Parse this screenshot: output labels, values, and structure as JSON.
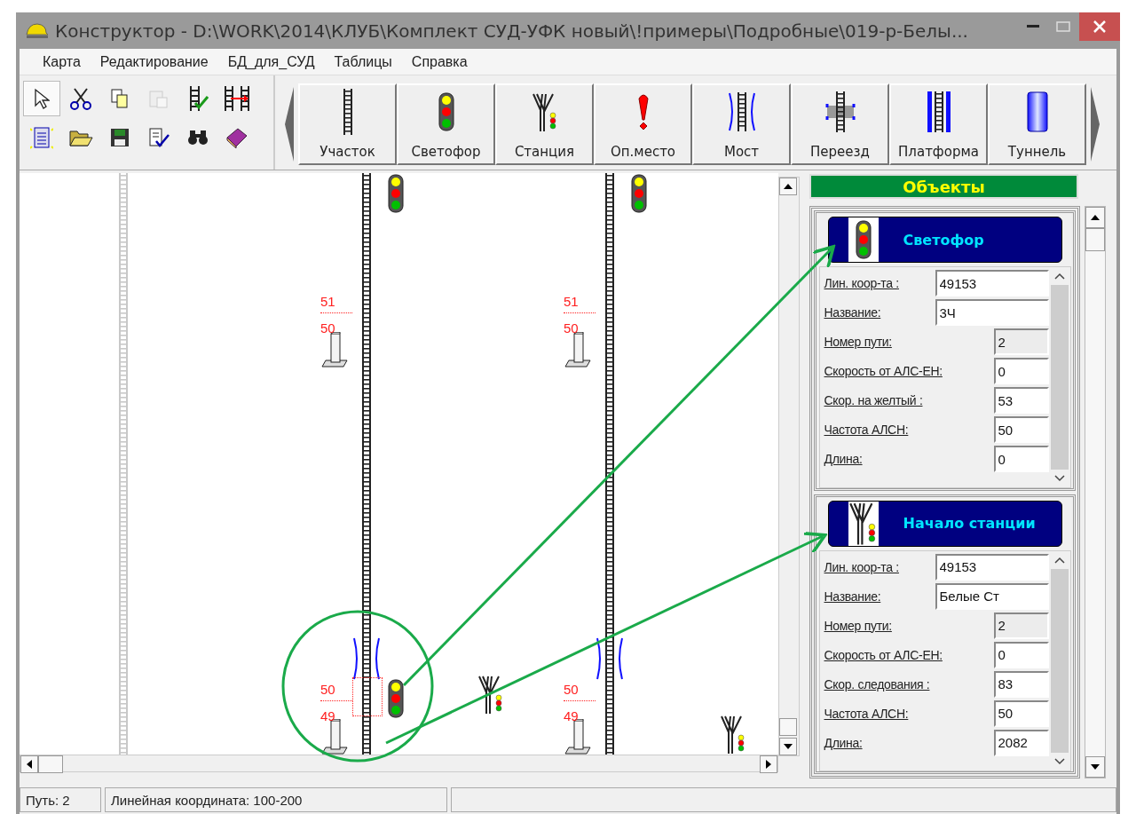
{
  "window": {
    "title": "Конструктор - D:\\WORK\\2014\\КЛУБ\\Комплект СУД-УФК новый\\!примеры\\Подробные\\019-р-Белы..."
  },
  "menu": [
    "Карта",
    "Редактирование",
    "БД_для_СУД",
    "Таблицы",
    "Справка"
  ],
  "tools": [
    [
      {
        "kind": "pointer",
        "selected": true,
        "disabled": false
      },
      {
        "kind": "cut",
        "selected": false,
        "disabled": false
      },
      {
        "kind": "copy",
        "selected": false,
        "disabled": false
      },
      {
        "kind": "paste",
        "selected": false,
        "disabled": true
      },
      {
        "kind": "check-track",
        "selected": false,
        "disabled": false
      },
      {
        "kind": "move-track",
        "selected": false,
        "disabled": false
      }
    ],
    [
      {
        "kind": "new",
        "selected": false,
        "disabled": false
      },
      {
        "kind": "open",
        "selected": false,
        "disabled": false
      },
      {
        "kind": "save",
        "selected": false,
        "disabled": false
      },
      {
        "kind": "verify",
        "selected": false,
        "disabled": false
      },
      {
        "kind": "find",
        "selected": false,
        "disabled": false
      },
      {
        "kind": "help",
        "selected": false,
        "disabled": false
      }
    ]
  ],
  "palette": [
    {
      "kind": "track",
      "label": "Участок"
    },
    {
      "kind": "signal",
      "label": "Светофор"
    },
    {
      "kind": "station",
      "label": "Станция"
    },
    {
      "kind": "danger",
      "label": "Оп.место"
    },
    {
      "kind": "bridge",
      "label": "Мост"
    },
    {
      "kind": "crossing",
      "label": "Переезд"
    },
    {
      "kind": "platform",
      "label": "Платформа"
    },
    {
      "kind": "tunnel",
      "label": "Туннель"
    }
  ],
  "canvas": {
    "marks": [
      {
        "upper": "51",
        "lower": "50",
        "selected": false
      },
      {
        "upper": "51",
        "lower": "50",
        "selected": false
      },
      {
        "upper": "50",
        "lower": "49",
        "selected": true
      },
      {
        "upper": "50",
        "lower": "49",
        "selected": false
      }
    ]
  },
  "panel": {
    "title": "Объекты",
    "cards": [
      {
        "kind": "signal",
        "title": "Светофор",
        "fields": [
          {
            "kind": "text",
            "label": "Лин. коор-та :",
            "value": "49153",
            "disabled": false
          },
          {
            "kind": "text",
            "label": "Название:",
            "value": "3Ч",
            "disabled": false
          },
          {
            "kind": "number",
            "label": "Номер пути:",
            "value": "2",
            "disabled": true
          },
          {
            "kind": "number",
            "label": "Скорость от АЛС-ЕН:",
            "value": "0",
            "disabled": false
          },
          {
            "kind": "number",
            "label": "Скор. на желтый :",
            "value": "53",
            "disabled": false
          },
          {
            "kind": "number",
            "label": "Частота АЛСН:",
            "value": "50",
            "disabled": false
          },
          {
            "kind": "number",
            "label": "Длина:",
            "value": "0",
            "disabled": false
          }
        ]
      },
      {
        "kind": "station",
        "title": "Начало станции",
        "fields": [
          {
            "kind": "text",
            "label": "Лин. коор-та :",
            "value": "49153",
            "disabled": false
          },
          {
            "kind": "text",
            "label": "Название:",
            "value": "Белые Ст",
            "disabled": false
          },
          {
            "kind": "number",
            "label": "Номер пути:",
            "value": "2",
            "disabled": true
          },
          {
            "kind": "number",
            "label": "Скорость от АЛС-ЕН:",
            "value": "0",
            "disabled": false
          },
          {
            "kind": "number",
            "label": "Скор. следования :",
            "value": "83",
            "disabled": false
          },
          {
            "kind": "number",
            "label": "Частота АЛСН:",
            "value": "50",
            "disabled": false
          },
          {
            "kind": "number",
            "label": "Длина:",
            "value": "2082",
            "disabled": false
          }
        ]
      }
    ]
  },
  "status_bar": [
    "Путь: 2",
    "Линейная координата: 100-200"
  ]
}
